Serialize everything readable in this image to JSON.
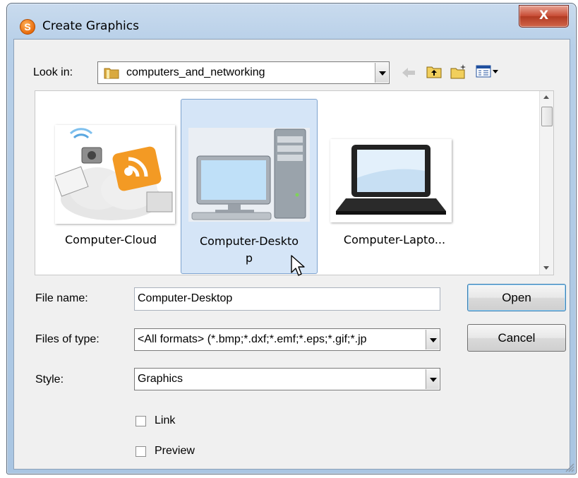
{
  "window": {
    "title": "Create Graphics",
    "close_label": "X"
  },
  "lookin": {
    "label": "Look in:",
    "folder": "computers_and_networking"
  },
  "items": [
    {
      "name": "Computer-Cloud",
      "caption_lines": [
        "Computer-Cloud"
      ]
    },
    {
      "name": "Computer-Desktop",
      "caption_lines": [
        "Computer-Deskto",
        "p"
      ],
      "selected": true
    },
    {
      "name": "Computer-Laptop",
      "caption_lines": [
        "Computer-Lapto..."
      ]
    }
  ],
  "form": {
    "filename_label": "File name:",
    "filename_value": "Computer-Desktop",
    "filetype_label": "Files of type:",
    "filetype_value": "<All formats> (*.bmp;*.dxf;*.emf;*.eps;*.gif;*.jp",
    "style_label": "Style:",
    "style_value": "Graphics",
    "link_label": "Link",
    "preview_label": "Preview",
    "link_checked": false,
    "preview_checked": false
  },
  "buttons": {
    "open": "Open",
    "cancel": "Cancel"
  },
  "colors": {
    "selection": "#d5e5f7",
    "selection_border": "#7da2ce",
    "close": "#c74a32",
    "chrome": "#b7cfe8"
  },
  "icons": [
    "app-icon",
    "folder-icon",
    "back-arrow-icon",
    "up-folder-icon",
    "new-folder-icon",
    "view-menu-icon",
    "mouse-cursor-icon"
  ]
}
